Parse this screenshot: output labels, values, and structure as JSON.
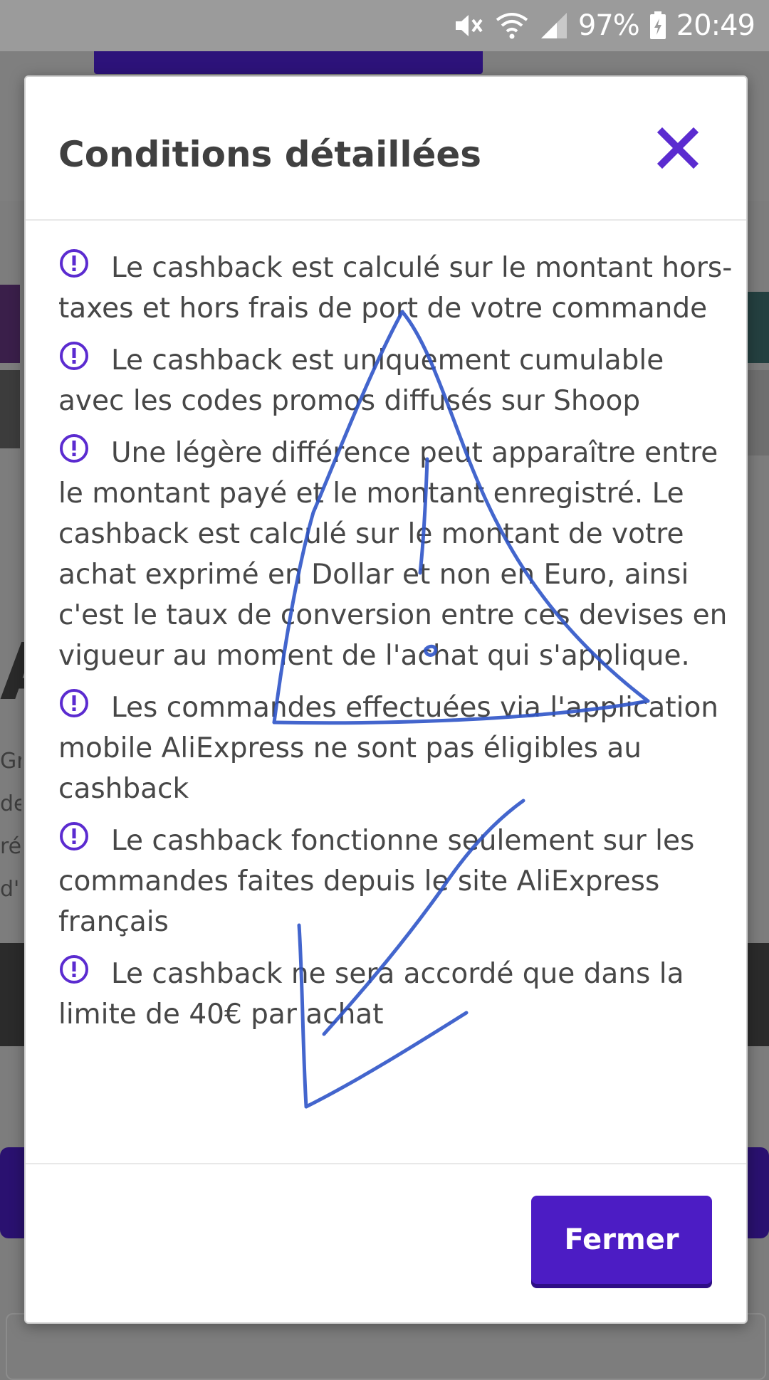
{
  "status_bar": {
    "battery_percent": "97%",
    "time": "20:49",
    "icons": [
      "mute-icon",
      "wifi-icon",
      "signal-icon",
      "battery-charging-icon"
    ]
  },
  "background": {
    "big_letter": "A",
    "side_text": [
      "Gr",
      "de",
      "ré",
      "d'"
    ]
  },
  "modal": {
    "title": "Conditions détaillées",
    "close_icon": "close-icon",
    "conditions": [
      {
        "icon": "info-icon",
        "text": "Le cashback est calculé sur le montant hors-taxes et hors frais de port de votre commande"
      },
      {
        "icon": "info-icon",
        "text": "Le cashback est uniquement cumulable avec les codes promos diffusés sur Shoop"
      },
      {
        "icon": "info-icon",
        "text": "Une légère différence peut apparaître entre le montant payé et le montant enregistré. Le cashback est calculé sur le montant de votre achat exprimé en Dollar et non en Euro, ainsi c'est le taux de conversion entre ces devises en vigueur au moment de l'achat qui s'applique."
      },
      {
        "icon": "info-icon",
        "text": "Les commandes effectuées via l'application mobile AliExpress ne sont pas éligibles au cashback"
      },
      {
        "icon": "info-icon",
        "text": "Le cashback fonctionne seulement sur les commandes faites depuis le site AliExpress français"
      },
      {
        "icon": "info-icon",
        "text": "Le cashback ne sera accordé que dans la limite de 40€ par achat"
      }
    ],
    "footer_button": "Fermer"
  },
  "colors": {
    "accent": "#4c1cc4",
    "icon": "#5b2bd0",
    "ink": "#2f55c8"
  }
}
